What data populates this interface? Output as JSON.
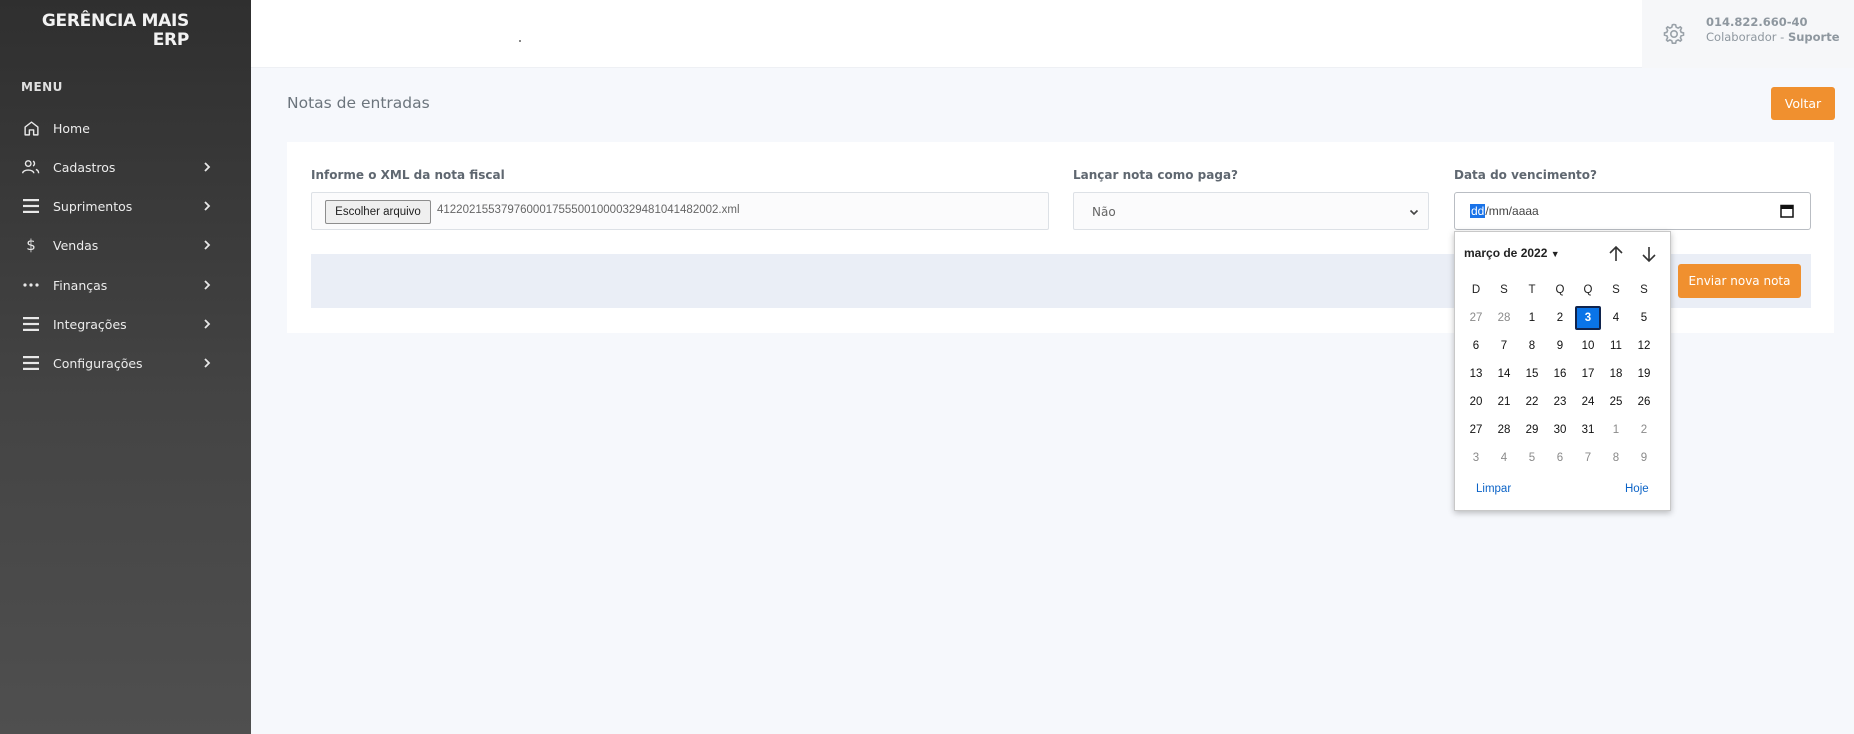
{
  "sidebar": {
    "logo_line1": "GERÊNCIA MAIS",
    "logo_line2": "ERP",
    "menu_title": "MENU",
    "items": [
      {
        "label": "Home",
        "icon": "home-icon"
      },
      {
        "label": "Cadastros",
        "icon": "users-icon"
      },
      {
        "label": "Suprimentos",
        "icon": "bars-icon"
      },
      {
        "label": "Vendas",
        "icon": "dollar-icon"
      },
      {
        "label": "Finanças",
        "icon": "dots-icon"
      },
      {
        "label": "Integrações",
        "icon": "bars-icon"
      },
      {
        "label": "Configurações",
        "icon": "bars-icon"
      }
    ]
  },
  "header": {
    "user_id": "014.822.660-40",
    "user_role": "Colaborador - ",
    "user_role_bold": "Suporte"
  },
  "page": {
    "title": "Notas de entradas",
    "back_label": "Voltar"
  },
  "form": {
    "xml_label": "Informe o XML da nota fiscal",
    "file_button": "Escolher arquivo",
    "file_name": "41220215537976000175550010000329481041482002.xml",
    "paid_label": "Lançar nota como paga?",
    "paid_value": "Não",
    "due_label": "Data do vencimento?",
    "date_dd": "dd",
    "date_rest": "/mm/aaaa",
    "send_label": "Enviar nova nota"
  },
  "calendar": {
    "month_label": "março de 2022",
    "weekdays": [
      "D",
      "S",
      "T",
      "Q",
      "Q",
      "S",
      "S"
    ],
    "weeks": [
      [
        "27",
        "28",
        "1",
        "2",
        "3",
        "4",
        "5"
      ],
      [
        "6",
        "7",
        "8",
        "9",
        "10",
        "11",
        "12"
      ],
      [
        "13",
        "14",
        "15",
        "16",
        "17",
        "18",
        "19"
      ],
      [
        "20",
        "21",
        "22",
        "23",
        "24",
        "25",
        "26"
      ],
      [
        "27",
        "28",
        "29",
        "30",
        "31",
        "1",
        "2"
      ],
      [
        "3",
        "4",
        "5",
        "6",
        "7",
        "8",
        "9"
      ]
    ],
    "selected_day": "3",
    "clear_label": "Limpar",
    "today_label": "Hoje"
  },
  "colors": {
    "accent": "#f0902f",
    "selected_day": "#0a74e8"
  }
}
